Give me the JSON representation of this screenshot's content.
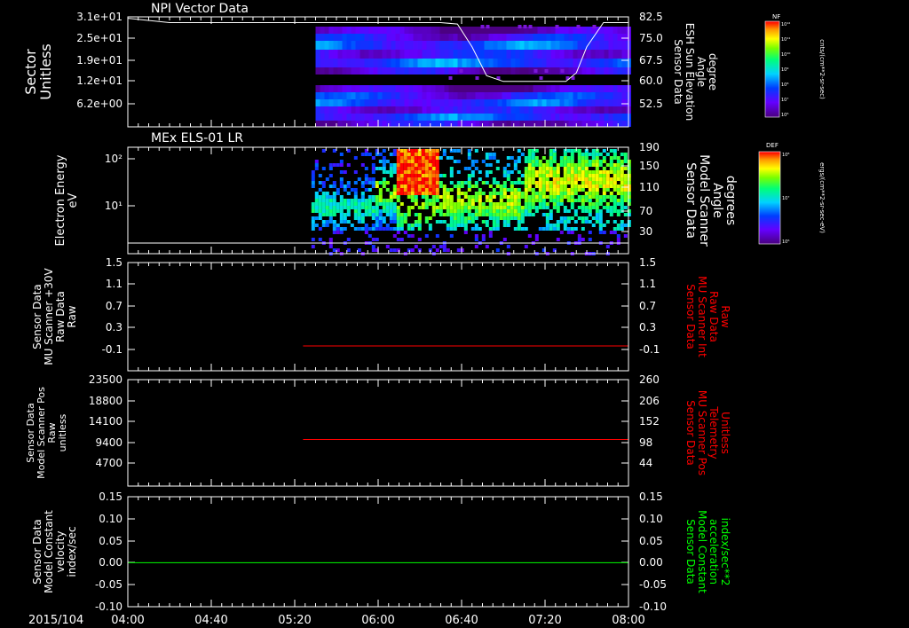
{
  "colors": {
    "background": "#000000",
    "foreground": "#ffffff",
    "scanner_int": "#ff0000",
    "scanner_pos": "#ff0000",
    "accel": "#00ff00"
  },
  "time_axis": {
    "date_label": "2015/104",
    "ticks": [
      "04:00",
      "04:40",
      "05:20",
      "06:00",
      "06:40",
      "07:20",
      "08:00"
    ],
    "range": [
      "04:00",
      "08:00"
    ]
  },
  "chart_data": [
    {
      "type": "heatmap",
      "title": "NPI Vector Data",
      "ylabel_lines": [
        "Sector",
        "Unitless"
      ],
      "y_ticks": [
        "3.1e+01",
        "2.5e+01",
        "1.9e+01",
        "1.2e+01",
        "6.2e+00"
      ],
      "right_ticks": [
        "82.5",
        "75.0",
        "67.5",
        "60.0",
        "52.5"
      ],
      "right_label_lines": [
        "Sensor Data",
        "ESH Sun Elevation",
        "Angle",
        "degree"
      ],
      "right_label_color": "#ffffff",
      "data_start": "05:30",
      "line_series": {
        "name": "ESH Sun Elevation Angle",
        "x": [
          "04:00",
          "04:20",
          "05:30",
          "06:30",
          "06:38",
          "06:45",
          "06:52",
          "07:00",
          "07:30",
          "07:35",
          "07:40",
          "07:48",
          "08:00"
        ],
        "y": [
          82.0,
          80.5,
          80.5,
          80.5,
          80.0,
          72.0,
          62.0,
          60.0,
          60.0,
          63.0,
          72.0,
          80.5,
          80.5
        ]
      },
      "colorbar": {
        "label": "NF",
        "tick_labels": [
          "10¹²",
          "10¹¹",
          "10¹⁰",
          "10⁹",
          "10⁸",
          "10⁷",
          "10⁶"
        ],
        "units": "cnts/(cm**2-sr-sec)"
      }
    },
    {
      "type": "heatmap",
      "title": "MEx ELS-01 LR",
      "ylabel_lines": [
        "Electron Energy",
        "eV"
      ],
      "y_ticks": [
        "10²",
        "10¹"
      ],
      "right_ticks": [
        "190",
        "150",
        "110",
        "70",
        "30"
      ],
      "right_label_lines": [
        "Sensor Data",
        "Model Scanner",
        "Angle",
        "degrees"
      ],
      "right_label_color": "#ffffff",
      "data_start": "05:28",
      "line_series": {
        "name": "Model Scanner Angle",
        "x": [
          "04:00",
          "08:00"
        ],
        "y": [
          4,
          4
        ]
      },
      "colorbar": {
        "label": "DEF",
        "tick_labels": [
          "10⁸",
          "10⁷",
          "10⁶"
        ],
        "units": "ergs/(cm**2-sr-sec-eV)"
      }
    },
    {
      "type": "line",
      "ylabel_lines": [
        "Sensor Data",
        "MU Scanner +30V",
        "Raw Data",
        "Raw"
      ],
      "y_ticks": [
        "1.5",
        "1.1",
        "0.7",
        "0.3",
        "-0.1"
      ],
      "ylim": [
        -0.5,
        1.5
      ],
      "right_ticks": [
        "1.5",
        "1.1",
        "0.7",
        "0.3",
        "-0.1"
      ],
      "right_label_lines": [
        "Sensor Data",
        "MU Scanner Int",
        "Raw Data",
        "Raw"
      ],
      "right_label_color": "#ff0000",
      "series": [
        {
          "name": "MU Scanner Int Raw Data",
          "x": [
            "05:24",
            "08:00"
          ],
          "y": [
            -0.05,
            -0.05
          ]
        }
      ]
    },
    {
      "type": "line",
      "ylabel_lines": [
        "Sensor Data",
        "Model Scanner Pos",
        "Raw",
        "unitless"
      ],
      "y_ticks": [
        "23500",
        "18800",
        "14100",
        "9400",
        "4700"
      ],
      "ylim": [
        0,
        23500
      ],
      "right_ticks": [
        "260",
        "206",
        "152",
        "98",
        "44"
      ],
      "right_label_lines": [
        "Sensor Data",
        "MU Scanner Pos",
        "Telemetry",
        "Unitless"
      ],
      "right_label_color": "#ff0000",
      "series": [
        {
          "name": "MU Scanner Pos Telemetry",
          "x": [
            "05:24",
            "08:00"
          ],
          "y": [
            105,
            105
          ]
        }
      ]
    },
    {
      "type": "line",
      "ylabel_lines": [
        "Sensor Data",
        "Model Constant",
        "velocity",
        "index/sec"
      ],
      "y_ticks": [
        "0.15",
        "0.10",
        "0.05",
        "0.00",
        "-0.05",
        "-0.10"
      ],
      "ylim": [
        -0.1,
        0.15
      ],
      "right_ticks": [
        "0.15",
        "0.10",
        "0.05",
        "0.00",
        "-0.05",
        "-0.10"
      ],
      "right_label_lines": [
        "Sensor Data",
        "Model Constant",
        "acceleration",
        "index/sec**2"
      ],
      "right_label_color": "#00ff00",
      "series": [
        {
          "name": "Model Constant acceleration",
          "x": [
            "04:00",
            "08:00"
          ],
          "y": [
            0.0,
            0.0
          ]
        }
      ]
    }
  ]
}
